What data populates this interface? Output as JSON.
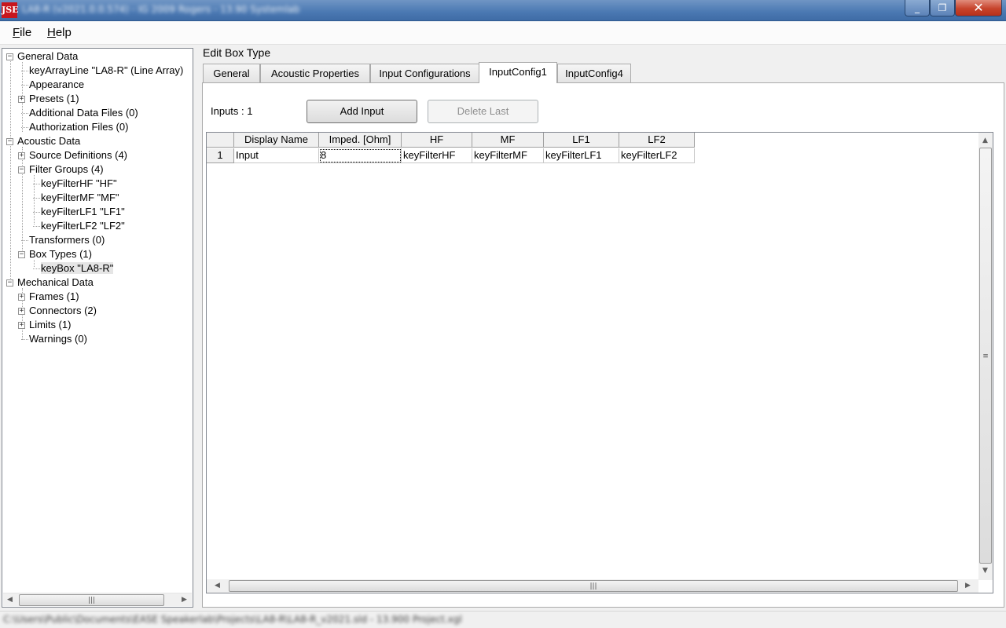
{
  "window": {
    "title": "LA8-R (v2021.0.0.574) - IG 2009 Rogers - 13.90 Systemlab",
    "icon_label": "JSE",
    "minimize_symbol": "_",
    "maximize_symbol": "❐",
    "close_symbol": "✕"
  },
  "menu": {
    "file": "File",
    "help": "Help"
  },
  "tree": {
    "items": [
      {
        "label": "General Data",
        "expander": "−"
      },
      {
        "label": "keyArrayLine \"LA8-R\" (Line Array)"
      },
      {
        "label": "Appearance"
      },
      {
        "label": "Presets  (1)",
        "expander": "+"
      },
      {
        "label": "Additional Data Files  (0)"
      },
      {
        "label": "Authorization Files  (0)"
      },
      {
        "label": "Acoustic Data",
        "expander": "−"
      },
      {
        "label": "Source Definitions  (4)",
        "expander": "+"
      },
      {
        "label": "Filter Groups  (4)",
        "expander": "−"
      },
      {
        "label": "keyFilterHF \"HF\""
      },
      {
        "label": "keyFilterMF \"MF\""
      },
      {
        "label": "keyFilterLF1 \"LF1\""
      },
      {
        "label": "keyFilterLF2 \"LF2\""
      },
      {
        "label": "Transformers  (0)"
      },
      {
        "label": "Box Types  (1)",
        "expander": "−"
      },
      {
        "label": "keyBox \"LA8-R\""
      },
      {
        "label": "Mechanical Data",
        "expander": "−"
      },
      {
        "label": "Frames  (1)",
        "expander": "+"
      },
      {
        "label": "Connectors  (2)",
        "expander": "+"
      },
      {
        "label": "Limits  (1)",
        "expander": "+"
      },
      {
        "label": "Warnings  (0)"
      }
    ]
  },
  "scroll_icons": {
    "left": "◀",
    "right": "▶",
    "up": "▲",
    "down": "▼",
    "grip_h": "|||",
    "grip_v": "≡"
  },
  "editor": {
    "title": "Edit Box Type",
    "tabs": [
      "General",
      "Acoustic Properties",
      "Input Configurations",
      "InputConfig1",
      "InputConfig4"
    ],
    "active_tab": "InputConfig1",
    "inputs_label": "Inputs : 1",
    "add_input": "Add Input",
    "delete_last": "Delete Last",
    "grid": {
      "columns": [
        "Display Name",
        "Imped. [Ohm]",
        "HF",
        "MF",
        "LF1",
        "LF2"
      ],
      "rows": [
        {
          "index": "1",
          "cells": [
            "Input",
            "8",
            "keyFilterHF",
            "keyFilterMF",
            "keyFilterLF1",
            "keyFilterLF2"
          ]
        }
      ]
    }
  },
  "status": {
    "text": "C:\\Users\\Public\\Documents\\EASE Speakerlab\\Projects\\LA8-R\\LA8-R_v2021.sld - 13.900 Project.xgl"
  }
}
